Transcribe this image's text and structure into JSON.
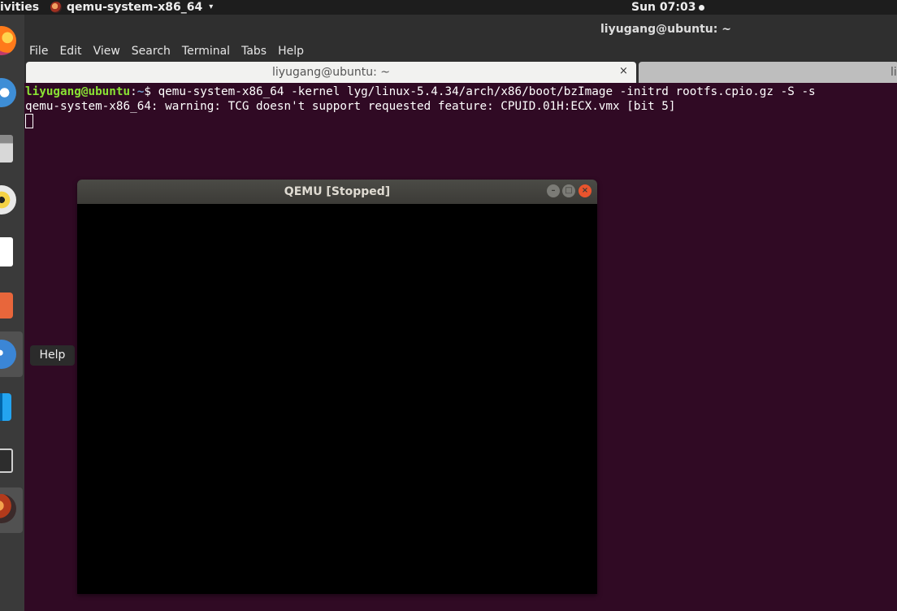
{
  "topbar": {
    "activities": "ivities",
    "app_menu": "qemu-system-x86_64",
    "app_menu_arrow": "▾",
    "clock": "Sun 07:03"
  },
  "terminal_window": {
    "title": "liyugang@ubuntu: ~",
    "menu": [
      "File",
      "Edit",
      "View",
      "Search",
      "Terminal",
      "Tabs",
      "Help"
    ],
    "tabs": [
      {
        "label": "liyugang@ubuntu: ~",
        "close": "×",
        "active": true
      },
      {
        "label": "li",
        "active": false
      }
    ],
    "lines": {
      "prompt_user": "liyugang@ubuntu",
      "prompt_sep": ":",
      "prompt_path": "~",
      "prompt_end": "$ ",
      "command": "qemu-system-x86_64 -kernel lyg/linux-5.4.34/arch/x86/boot/bzImage -initrd rootfs.cpio.gz -S -s",
      "output": "qemu-system-x86_64: warning: TCG doesn't support requested feature: CPUID.01H:ECX.vmx [bit 5]"
    }
  },
  "dock": {
    "items": [
      {
        "icon": "firefox-icon"
      },
      {
        "icon": "thunderbird-icon"
      },
      {
        "icon": "files-icon"
      },
      {
        "icon": "rhythmbox-icon"
      },
      {
        "icon": "libreoffice-writer-icon"
      },
      {
        "icon": "software-center-icon"
      },
      {
        "icon": "help-icon"
      },
      {
        "icon": "vscode-icon"
      },
      {
        "icon": "terminal-icon"
      },
      {
        "icon": "qemu-icon"
      }
    ],
    "tooltip": "Help"
  },
  "qemu_window": {
    "title": "QEMU [Stopped]",
    "min": "–",
    "max": "□",
    "close": "×"
  },
  "colors": {
    "terminal_bg": "#300a24",
    "prompt_user": "#8ae234",
    "prompt_path": "#729fcf",
    "close_button": "#e9542d"
  }
}
